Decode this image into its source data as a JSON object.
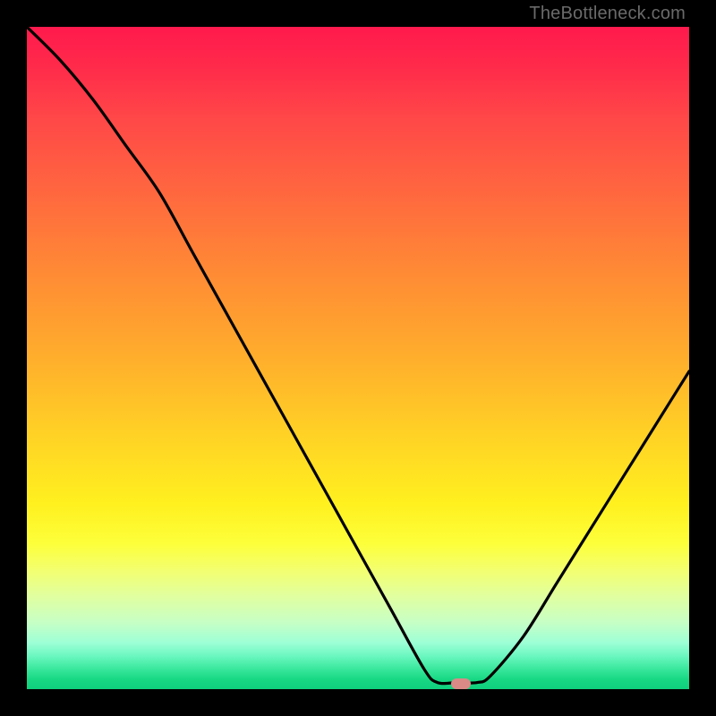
{
  "watermark": "TheBottleneck.com",
  "marker": {
    "x_pct": 65.5,
    "y_pct": 99.2,
    "color": "#d98a87"
  },
  "chart_data": {
    "type": "line",
    "title": "",
    "xlabel": "",
    "ylabel": "",
    "xlim": [
      0,
      100
    ],
    "ylim": [
      0,
      100
    ],
    "grid": false,
    "legend": false,
    "note": "y is distance-from-bottom as % of plot height; curve samples estimated from pixels",
    "series": [
      {
        "name": "bottleneck-curve",
        "x": [
          0,
          5,
          10,
          15,
          20,
          25,
          30,
          35,
          40,
          45,
          50,
          55,
          60,
          62,
          65,
          68,
          70,
          75,
          80,
          85,
          90,
          95,
          100
        ],
        "y": [
          100,
          95,
          89,
          82,
          75,
          66,
          57,
          48,
          39,
          30,
          21,
          12,
          3,
          1,
          1,
          1,
          2,
          8,
          16,
          24,
          32,
          40,
          48
        ]
      }
    ],
    "background_gradient": {
      "top": "#ff1a4d",
      "mid": "#ffd325",
      "bottom": "#0fd07d"
    },
    "highlight_marker": {
      "x": 65.5,
      "y": 0.8
    }
  }
}
